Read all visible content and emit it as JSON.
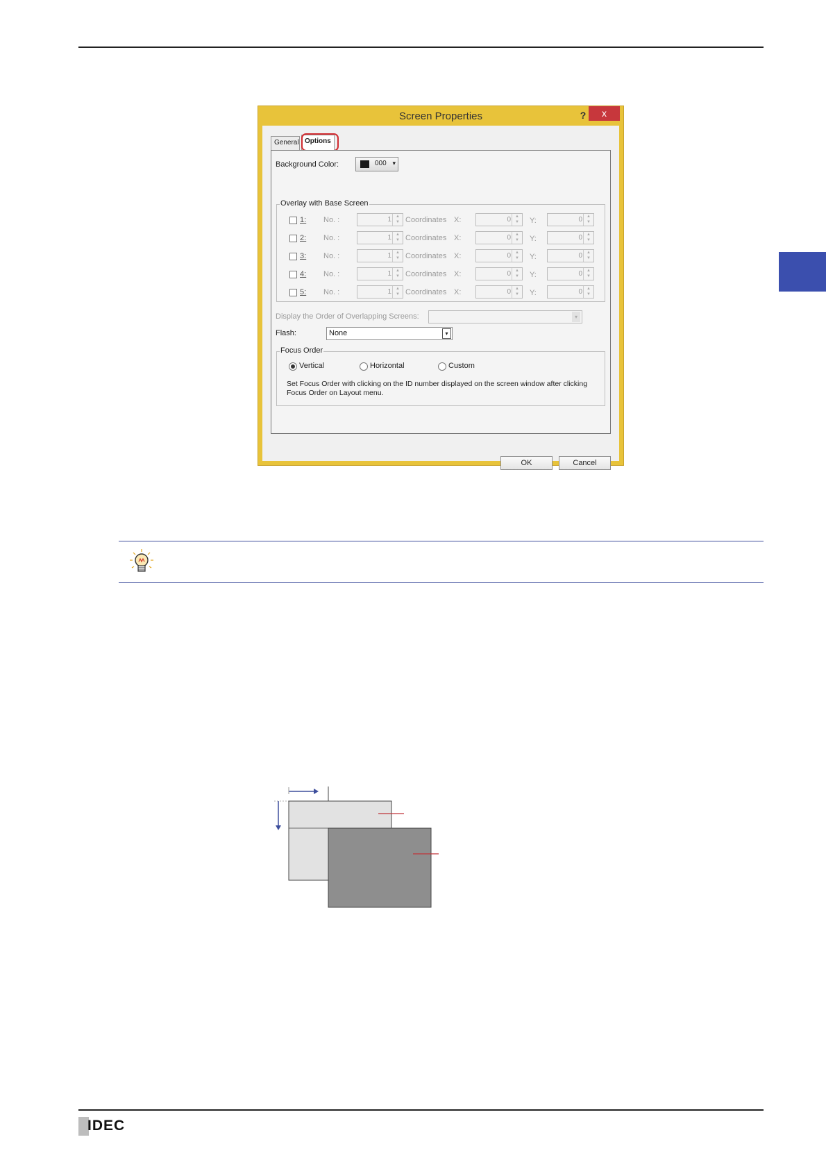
{
  "dialog": {
    "title": "Screen Properties",
    "help_label": "?",
    "close_label": "x",
    "tabs": [
      {
        "label": "General"
      },
      {
        "label": "Options"
      }
    ],
    "background_color": {
      "label": "Background Color:",
      "value": "000",
      "swatch": "#1a1a1a"
    },
    "overlay": {
      "title": "Overlay with Base Screen",
      "rows": [
        {
          "label": "1:",
          "no_label": "No. :",
          "no": "1",
          "coord_label": "Coordinates",
          "x_label": "X:",
          "x": "0",
          "y_label": "Y:",
          "y": "0"
        },
        {
          "label": "2:",
          "no_label": "No. :",
          "no": "1",
          "coord_label": "Coordinates",
          "x_label": "X:",
          "x": "0",
          "y_label": "Y:",
          "y": "0"
        },
        {
          "label": "3:",
          "no_label": "No. :",
          "no": "1",
          "coord_label": "Coordinates",
          "x_label": "X:",
          "x": "0",
          "y_label": "Y:",
          "y": "0"
        },
        {
          "label": "4:",
          "no_label": "No. :",
          "no": "1",
          "coord_label": "Coordinates",
          "x_label": "X:",
          "x": "0",
          "y_label": "Y:",
          "y": "0"
        },
        {
          "label": "5:",
          "no_label": "No. :",
          "no": "1",
          "coord_label": "Coordinates",
          "x_label": "X:",
          "x": "0",
          "y_label": "Y:",
          "y": "0"
        }
      ]
    },
    "display_order_label": "Display the Order of Overlapping Screens:",
    "flash": {
      "label": "Flash:",
      "value": "None"
    },
    "focus_order": {
      "title": "Focus Order",
      "options": [
        {
          "label": "Vertical",
          "selected": true
        },
        {
          "label": "Horizontal",
          "selected": false
        },
        {
          "label": "Custom",
          "selected": false
        }
      ],
      "note_line1": "Set Focus Order with clicking on the ID number displayed on the screen window after clicking",
      "note_line2": "Focus Order on Layout menu."
    },
    "ok_label": "OK",
    "cancel_label": "Cancel"
  },
  "footer": {
    "logo": "IDEC"
  },
  "colors": {
    "accent": "#3b4fae",
    "highlight": "#d12b30",
    "dialog_frame": "#e8c33a"
  }
}
